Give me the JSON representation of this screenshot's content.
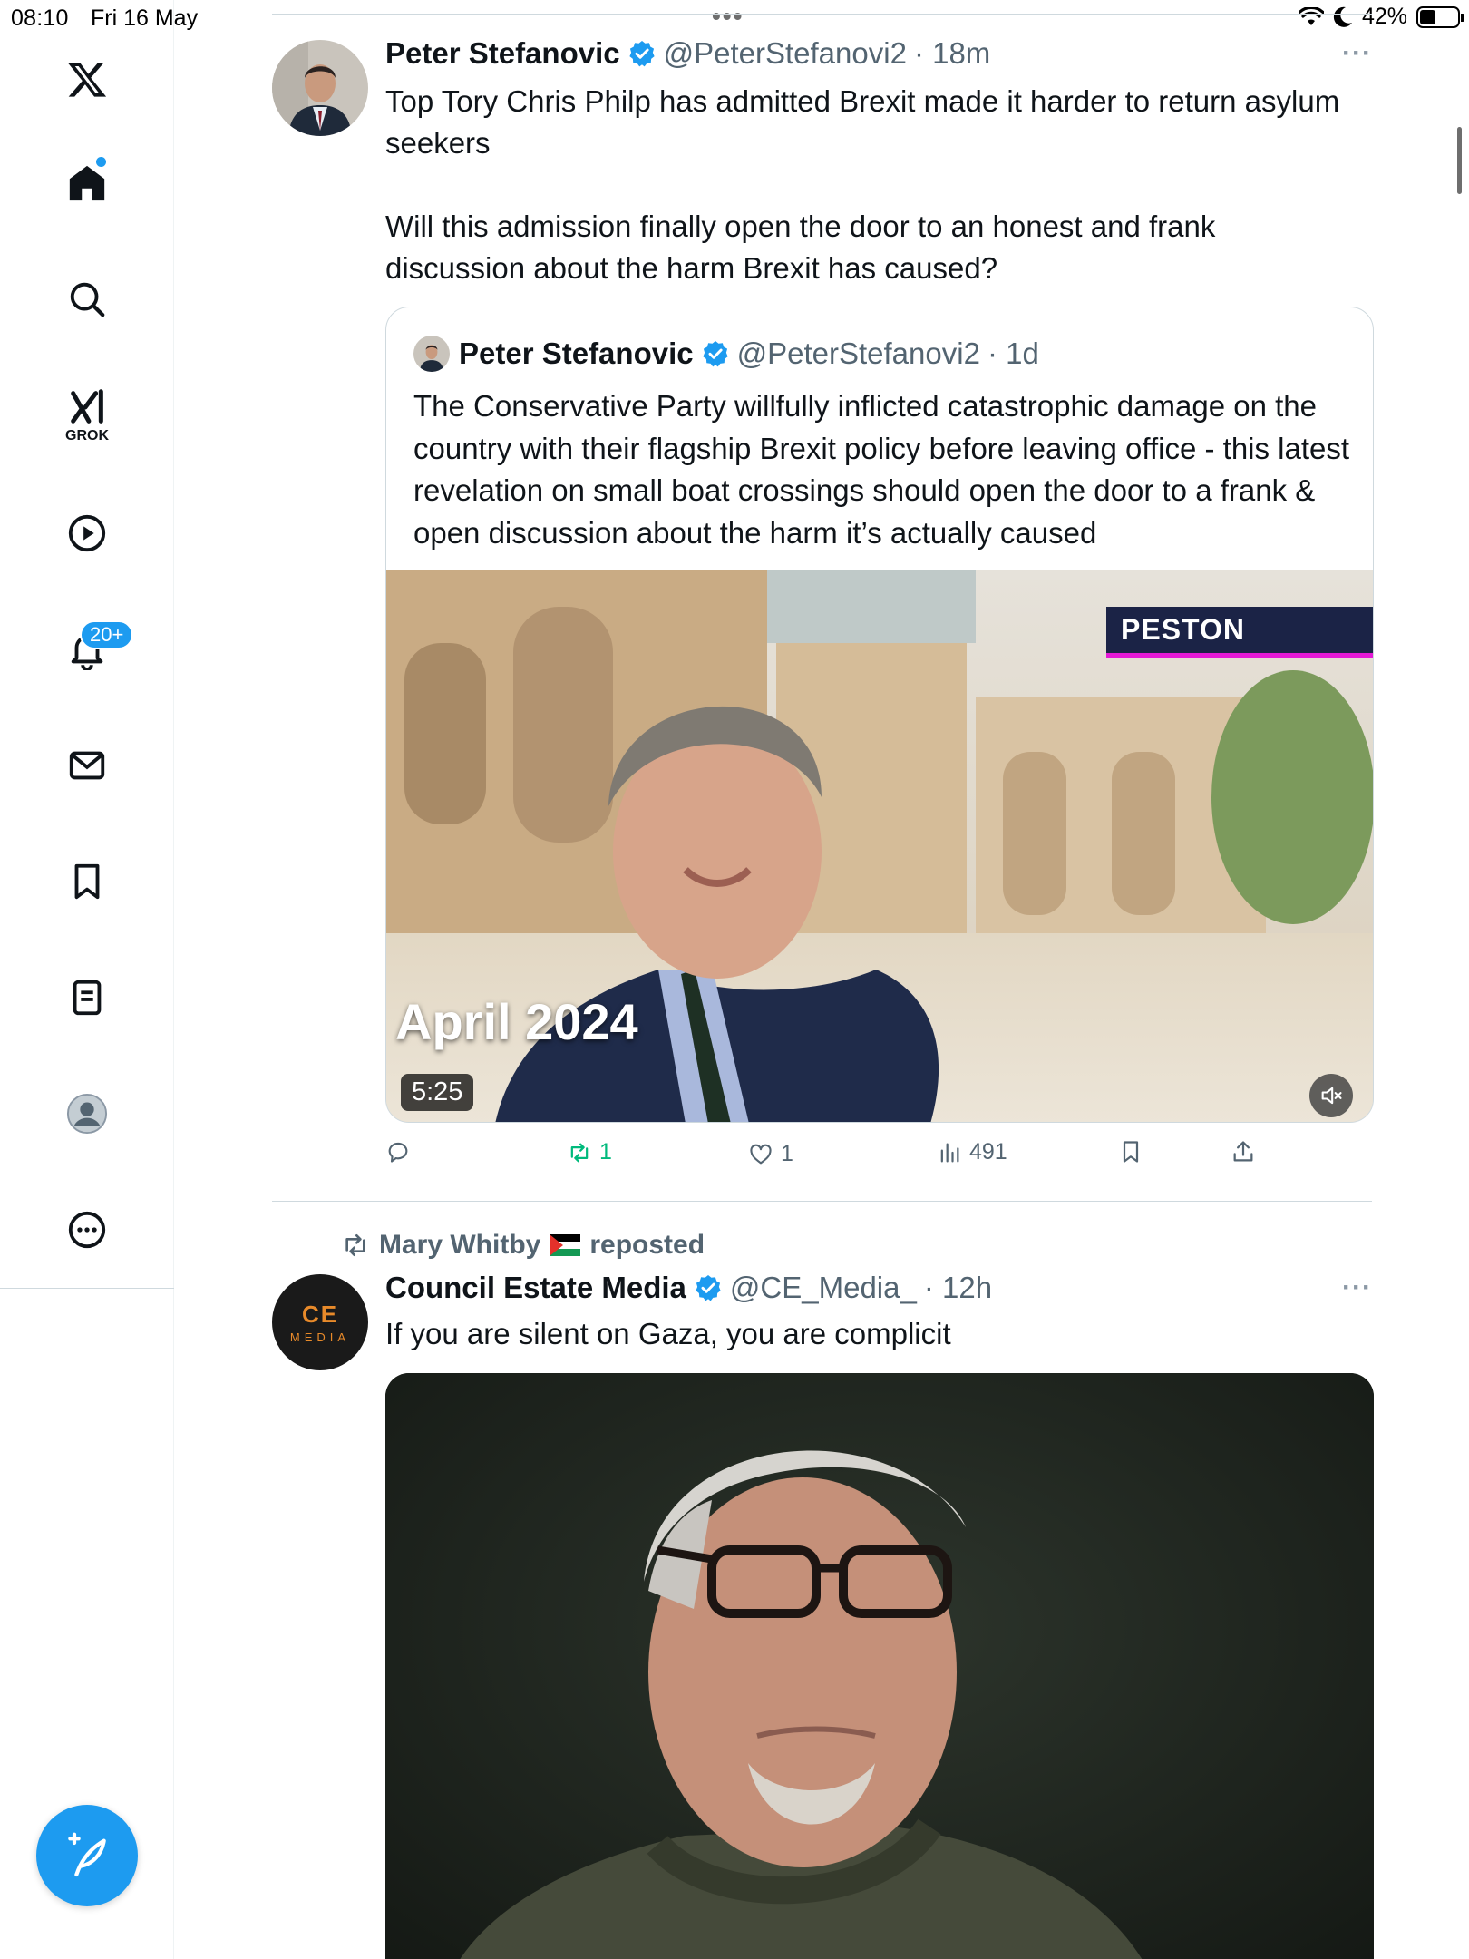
{
  "status_bar": {
    "time": "08:10",
    "date": "Fri 16 May",
    "battery": "42%",
    "battery_level": 0.42
  },
  "sidebar": {
    "grok_label": "GROK",
    "notifications_badge": "20+"
  },
  "tweets": [
    {
      "name": "Peter Stefanovic",
      "handle": "@PeterStefanovi2",
      "time": "· 18m",
      "more": "···",
      "text": "Top Tory Chris Philp has admitted Brexit made it harder to return asylum seekers\n\nWill this admission finally open the door to an honest and frank discussion about the harm Brexit has caused?",
      "quote": {
        "name": "Peter Stefanovic",
        "handle": "@PeterStefanovi2",
        "time": "· 1d",
        "text": "The Conservative Party willfully inflicted catastrophic damage on the country with their flagship Brexit policy before leaving office - this latest revelation on small boat crossings should open the door to a frank & open discussion about the harm it’s actually caused",
        "video": {
          "caption": "April 2024",
          "duration": "5:25",
          "brand": "PESTON"
        }
      },
      "actions": {
        "replies": "",
        "reposts": "1",
        "likes": "1",
        "views": "491"
      }
    },
    {
      "reposted_by": "Mary Whitby",
      "reposted_label": "reposted",
      "name": "Council Estate Media",
      "handle": "@CE_Media_",
      "time": "· 12h",
      "more": "···",
      "avatar_text": {
        "line1": "CE",
        "line2": "MEDIA"
      },
      "text": "If you are silent on Gaza, you are complicit"
    }
  ],
  "colors": {
    "accent": "#1d9bf0",
    "repost_green": "#00ba7c",
    "secondary_text": "#536471"
  }
}
